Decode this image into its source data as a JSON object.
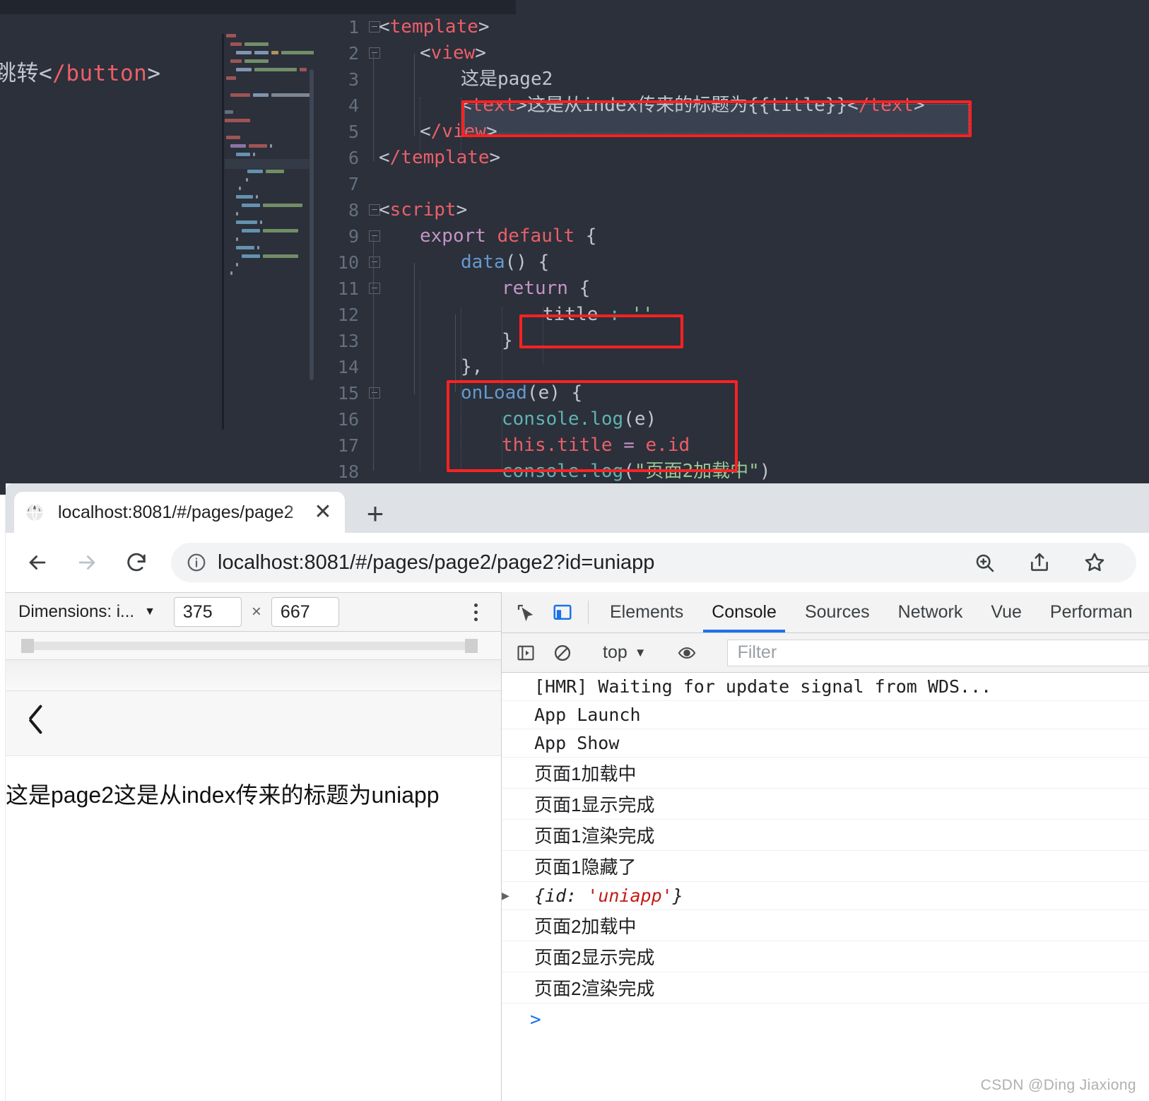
{
  "editor": {
    "left_pane_code": "跳转</button>",
    "lines": [
      {
        "n": "1",
        "fold": "minus",
        "indent": 0,
        "tokens": [
          {
            "t": "<",
            "c": "punc"
          },
          {
            "t": "template",
            "c": "tag"
          },
          {
            "t": ">",
            "c": "punc"
          }
        ]
      },
      {
        "n": "2",
        "fold": "minus",
        "indent": 1,
        "tokens": [
          {
            "t": "<",
            "c": "punc"
          },
          {
            "t": "view",
            "c": "tag"
          },
          {
            "t": ">",
            "c": "punc"
          }
        ]
      },
      {
        "n": "3",
        "fold": "",
        "indent": 2,
        "tokens": [
          {
            "t": "这是page2",
            "c": "plain"
          }
        ]
      },
      {
        "n": "4",
        "fold": "",
        "indent": 2,
        "tokens": [
          {
            "t": "<",
            "c": "punc"
          },
          {
            "t": "text",
            "c": "tag"
          },
          {
            "t": ">",
            "c": "punc"
          },
          {
            "t": "这是从index传来的标题为",
            "c": "plain"
          },
          {
            "t": "{{title}}",
            "c": "plain"
          },
          {
            "t": "<",
            "c": "punc"
          },
          {
            "t": "/text",
            "c": "tag"
          },
          {
            "t": ">",
            "c": "punc"
          }
        ]
      },
      {
        "n": "5",
        "fold": "",
        "indent": 1,
        "tokens": [
          {
            "t": "<",
            "c": "punc"
          },
          {
            "t": "/view",
            "c": "tag"
          },
          {
            "t": ">",
            "c": "punc"
          }
        ]
      },
      {
        "n": "6",
        "fold": "",
        "indent": 0,
        "tokens": [
          {
            "t": "<",
            "c": "punc"
          },
          {
            "t": "/template",
            "c": "tag"
          },
          {
            "t": ">",
            "c": "punc"
          }
        ]
      },
      {
        "n": "7",
        "fold": "",
        "indent": 0,
        "tokens": []
      },
      {
        "n": "8",
        "fold": "minus",
        "indent": 0,
        "tokens": [
          {
            "t": "<",
            "c": "punc"
          },
          {
            "t": "script",
            "c": "tag"
          },
          {
            "t": ">",
            "c": "punc"
          }
        ]
      },
      {
        "n": "9",
        "fold": "minus",
        "indent": 1,
        "tokens": [
          {
            "t": "export",
            "c": "kw"
          },
          {
            "t": " ",
            "c": "plain"
          },
          {
            "t": "default",
            "c": "tag"
          },
          {
            "t": " {",
            "c": "punc"
          }
        ]
      },
      {
        "n": "10",
        "fold": "minus",
        "indent": 2,
        "tokens": [
          {
            "t": "data",
            "c": "fn"
          },
          {
            "t": "() {",
            "c": "punc"
          }
        ]
      },
      {
        "n": "11",
        "fold": "minus",
        "indent": 3,
        "tokens": [
          {
            "t": "return",
            "c": "kw"
          },
          {
            "t": " {",
            "c": "punc"
          }
        ]
      },
      {
        "n": "12",
        "fold": "",
        "indent": 4,
        "tokens": [
          {
            "t": "title",
            "c": "plain"
          },
          {
            "t": " : ",
            "c": "prop"
          },
          {
            "t": "''",
            "c": "str"
          }
        ]
      },
      {
        "n": "13",
        "fold": "",
        "indent": 3,
        "tokens": [
          {
            "t": "}",
            "c": "punc"
          }
        ]
      },
      {
        "n": "14",
        "fold": "",
        "indent": 2,
        "tokens": [
          {
            "t": "},",
            "c": "punc"
          }
        ]
      },
      {
        "n": "15",
        "fold": "minus",
        "indent": 2,
        "tokens": [
          {
            "t": "onLoad",
            "c": "fn"
          },
          {
            "t": "(e) {",
            "c": "punc"
          }
        ]
      },
      {
        "n": "16",
        "fold": "",
        "indent": 3,
        "tokens": [
          {
            "t": "console",
            "c": "prop"
          },
          {
            "t": ".",
            "c": "prop"
          },
          {
            "t": "log",
            "c": "prop"
          },
          {
            "t": "(e)",
            "c": "punc"
          }
        ]
      },
      {
        "n": "17",
        "fold": "",
        "indent": 3,
        "tokens": [
          {
            "t": "this",
            "c": "var"
          },
          {
            "t": ".title ",
            "c": "var"
          },
          {
            "t": "=",
            "c": "op"
          },
          {
            "t": " e.id",
            "c": "var"
          }
        ]
      },
      {
        "n": "18",
        "fold": "",
        "indent": 3,
        "tokens": [
          {
            "t": "console",
            "c": "prop"
          },
          {
            "t": ".",
            "c": "prop"
          },
          {
            "t": "log",
            "c": "prop"
          },
          {
            "t": "(",
            "c": "punc"
          },
          {
            "t": "\"页面2加载中\"",
            "c": "str"
          },
          {
            "t": ")",
            "c": "punc"
          }
        ]
      }
    ],
    "highlight_annotations": [
      "text-line-box",
      "title-data-box",
      "onload-box"
    ]
  },
  "browser": {
    "tab": {
      "title": "localhost:8081/#/pages/page2",
      "close_label": "✕",
      "favicon": "globe-icon"
    },
    "new_tab_label": "+",
    "nav": {
      "back": "←",
      "forward": "→",
      "reload": "⟳",
      "info_icon": "ⓘ",
      "url_prefix": "localhost",
      "url": "localhost:8081/#/pages/page2/page2?id=uniapp",
      "zoom_icon": "zoom-in-icon",
      "share_icon": "share-icon",
      "bookmark_icon": "star-icon"
    }
  },
  "device_toolbar": {
    "dimensions_label": "Dimensions: i...",
    "caret": "▼",
    "width": "375",
    "times": "×",
    "height": "667",
    "more_label": "kebab-menu"
  },
  "preview": {
    "back_icon": "back-chevron-icon",
    "page_text": "这是page2这是从index传来的标题为uniapp"
  },
  "devtools": {
    "inspect_icon": "inspect-element-icon",
    "device_icon": "toggle-device-toolbar-icon",
    "tabs": [
      {
        "label": "Elements",
        "active": false
      },
      {
        "label": "Console",
        "active": true
      },
      {
        "label": "Sources",
        "active": false
      },
      {
        "label": "Network",
        "active": false
      },
      {
        "label": "Vue",
        "active": false
      },
      {
        "label": "Performan",
        "active": false
      }
    ],
    "filterbar": {
      "sidebar_icon": "console-sidebar-icon",
      "clear_icon": "clear-console-icon",
      "context": "top",
      "context_caret": "▼",
      "eye_icon": "live-expression-icon",
      "filter_placeholder": "Filter"
    },
    "logs": [
      {
        "text": "[HMR] Waiting for update signal from WDS...",
        "type": "mono"
      },
      {
        "text": "App Launch",
        "type": "mono"
      },
      {
        "text": "App Show",
        "type": "mono"
      },
      {
        "text": "页面1加载中",
        "type": "cjk"
      },
      {
        "text": "页面1显示完成",
        "type": "cjk"
      },
      {
        "text": "页面1渲染完成",
        "type": "cjk"
      },
      {
        "text": "页面1隐藏了",
        "type": "cjk"
      },
      {
        "text": "{id: 'uniapp'}",
        "type": "object",
        "expandable": true,
        "arrow": "▶",
        "obj_key": "{id: ",
        "obj_val": "'uniapp'",
        "obj_tail": "}"
      },
      {
        "text": "页面2加载中",
        "type": "cjk"
      },
      {
        "text": "页面2显示完成",
        "type": "cjk"
      },
      {
        "text": "页面2渲染完成",
        "type": "cjk"
      }
    ],
    "prompt": ">"
  },
  "watermark": "CSDN @Ding Jiaxiong",
  "colors": {
    "editor_bg": "#2b303b",
    "accent_blue": "#1a73e8",
    "highlight_red": "#fc2222",
    "tag_red": "#ec5f67",
    "string_green": "#99c794"
  }
}
